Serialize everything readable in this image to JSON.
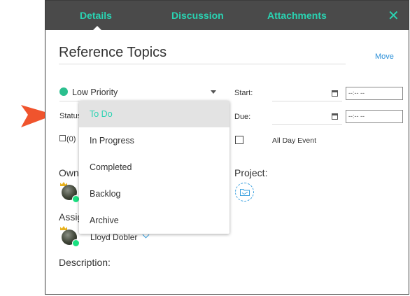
{
  "tabs": [
    "Details",
    "Discussion",
    "Attachments"
  ],
  "close_label": "✕",
  "title": "Reference Topics",
  "move_label": "Move",
  "priority": {
    "label": "Low Priority",
    "color": "#2bbf8e"
  },
  "status_label": "Status",
  "start_label": "Start:",
  "due_label": "Due:",
  "time_placeholder": "--:-- --",
  "notes_count": "(0)",
  "all_day_label": "All Day Event",
  "owner_label": "Owne",
  "project_label": "Project:",
  "assignee_label": "Assig",
  "assignee_name": "Lloyd Dobler",
  "description_label": "Description:",
  "status_options": [
    "To Do",
    "In Progress",
    "Completed",
    "Backlog",
    "Archive"
  ],
  "selected_status": "To Do",
  "colors": {
    "accent": "#2ad3b2",
    "header": "#4a4a4a",
    "link": "#2a8fd8",
    "arrow": "#f0542d"
  }
}
